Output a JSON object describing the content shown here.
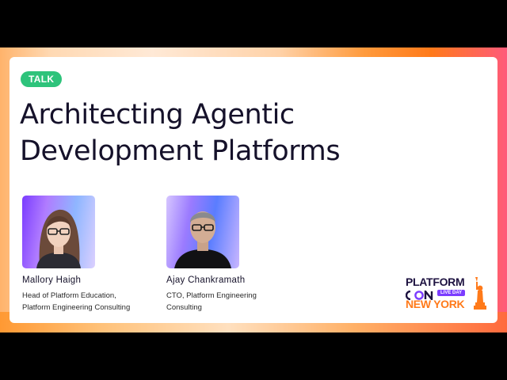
{
  "slide": {
    "badge": "TALK",
    "title_line1": "Architecting Agentic",
    "title_line2": "Development Platforms"
  },
  "speakers": [
    {
      "name": "Mallory  Haigh",
      "role": "Head of Platform Education,\nPlatform Engineering Consulting"
    },
    {
      "name": "Ajay Chankramath",
      "role": "CTO, Platform Engineering\nConsulting"
    }
  ],
  "logo": {
    "platform": "PLATFORM",
    "con": "CON",
    "live_day": "LIVE DAY",
    "city": "NEW YORK"
  },
  "colors": {
    "badge": "#2ec37b",
    "title": "#15112a",
    "brand_purple": "#7b3cff",
    "brand_orange": "#ff7a1a"
  }
}
